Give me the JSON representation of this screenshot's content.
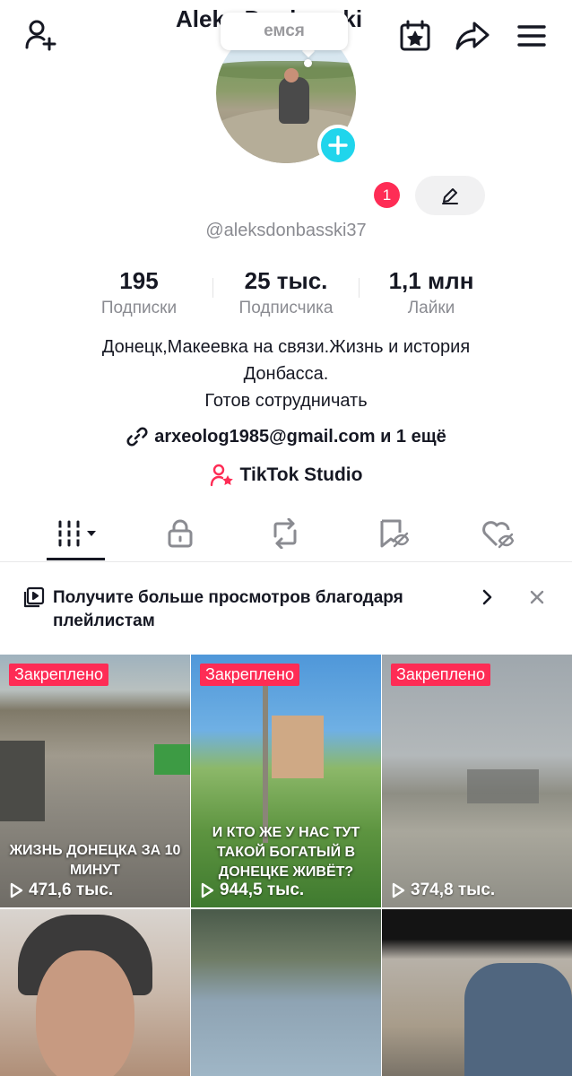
{
  "tooltip": {
    "text": "емся"
  },
  "profile": {
    "name": "Aleks Donbasski",
    "notification_count": "1",
    "handle": "@aleksdonbasski37"
  },
  "stats": [
    {
      "value": "195",
      "label": "Подписки"
    },
    {
      "value": "25 тыс.",
      "label": "Подписчика"
    },
    {
      "value": "1,1 млн",
      "label": "Лайки"
    }
  ],
  "bio": {
    "line1": "Донецк,Макеевка на связи.Жизнь и история",
    "line2": "Донбасса.",
    "line3": "Готов сотрудничать"
  },
  "link": {
    "text": "arxeolog1985@gmail.com и 1 ещё"
  },
  "studio": {
    "label": "TikTok Studio"
  },
  "promo": {
    "text": "Получите больше просмотров благодаря плейлистам"
  },
  "videos": [
    {
      "pinned": "Закреплено",
      "views": "471,6 тыс.",
      "overlay": "ЖИЗНЬ ДОНЕЦКА ЗА 10 МИНУТ"
    },
    {
      "pinned": "Закреплено",
      "views": "944,5 тыс.",
      "overlay": "И КТО ЖЕ У НАС ТУТ ТАКОЙ БОГАТЫЙ В ДОНЕЦКЕ ЖИВЁТ?"
    },
    {
      "pinned": "Закреплено",
      "views": "374,8 тыс.",
      "overlay": ""
    }
  ],
  "colors": {
    "accent": "#fe2c55",
    "avatar_add": "#20d5ec",
    "text": "#161823",
    "muted": "#8a8b91"
  }
}
